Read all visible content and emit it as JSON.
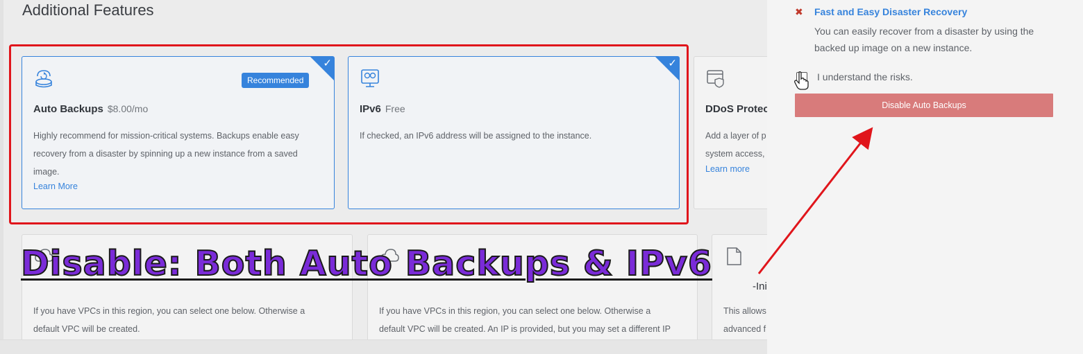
{
  "section_title": "Additional Features",
  "cards": {
    "auto_backups": {
      "title": "Auto Backups",
      "price": "$8.00/mo",
      "badge": "Recommended",
      "desc": "Highly recommend for mission-critical systems. Backups enable easy recovery from a disaster by spinning up a new instance from a saved image.",
      "link": "Learn More",
      "icon": "backup-icon",
      "selected": true
    },
    "ipv6": {
      "title": "IPv6",
      "price": "Free",
      "desc": "If checked, an IPv6 address will be assigned to the instance.",
      "icon": "ipv6-icon",
      "selected": true
    },
    "ddos": {
      "title": "DDoS Protec",
      "desc": "Add a layer of p system access,",
      "link": "Learn more",
      "icon": "ddos-shield-icon",
      "selected": false
    },
    "vpc1": {
      "desc": "If you have VPCs in this region, you can select one below. Otherwise a default VPC will be created.",
      "icon": "cloud-icon"
    },
    "vpc2": {
      "desc": "If you have VPCs in this region, you can select one below. Otherwise a default VPC will be created. An IP is provided, but you may set a different IP",
      "icon": "cloud-icon"
    },
    "cloudinit": {
      "title_fragment": "-Ini",
      "desc": "This allows advanced f",
      "icon": "document-icon"
    }
  },
  "overlay_caption": "Disable: Both Auto Backups & IPv6",
  "panel": {
    "heading": "Fast and Easy Disaster Recovery",
    "text": "You can easily recover from a disaster by using the backed up image on a new instance.",
    "checkbox_label": "I understand the risks.",
    "button_label": "Disable Auto Backups"
  },
  "colors": {
    "accent": "#3683dc",
    "highlight_border": "#e0151b",
    "disable_button": "#d87b7b",
    "caption": "#7a2bd8"
  }
}
